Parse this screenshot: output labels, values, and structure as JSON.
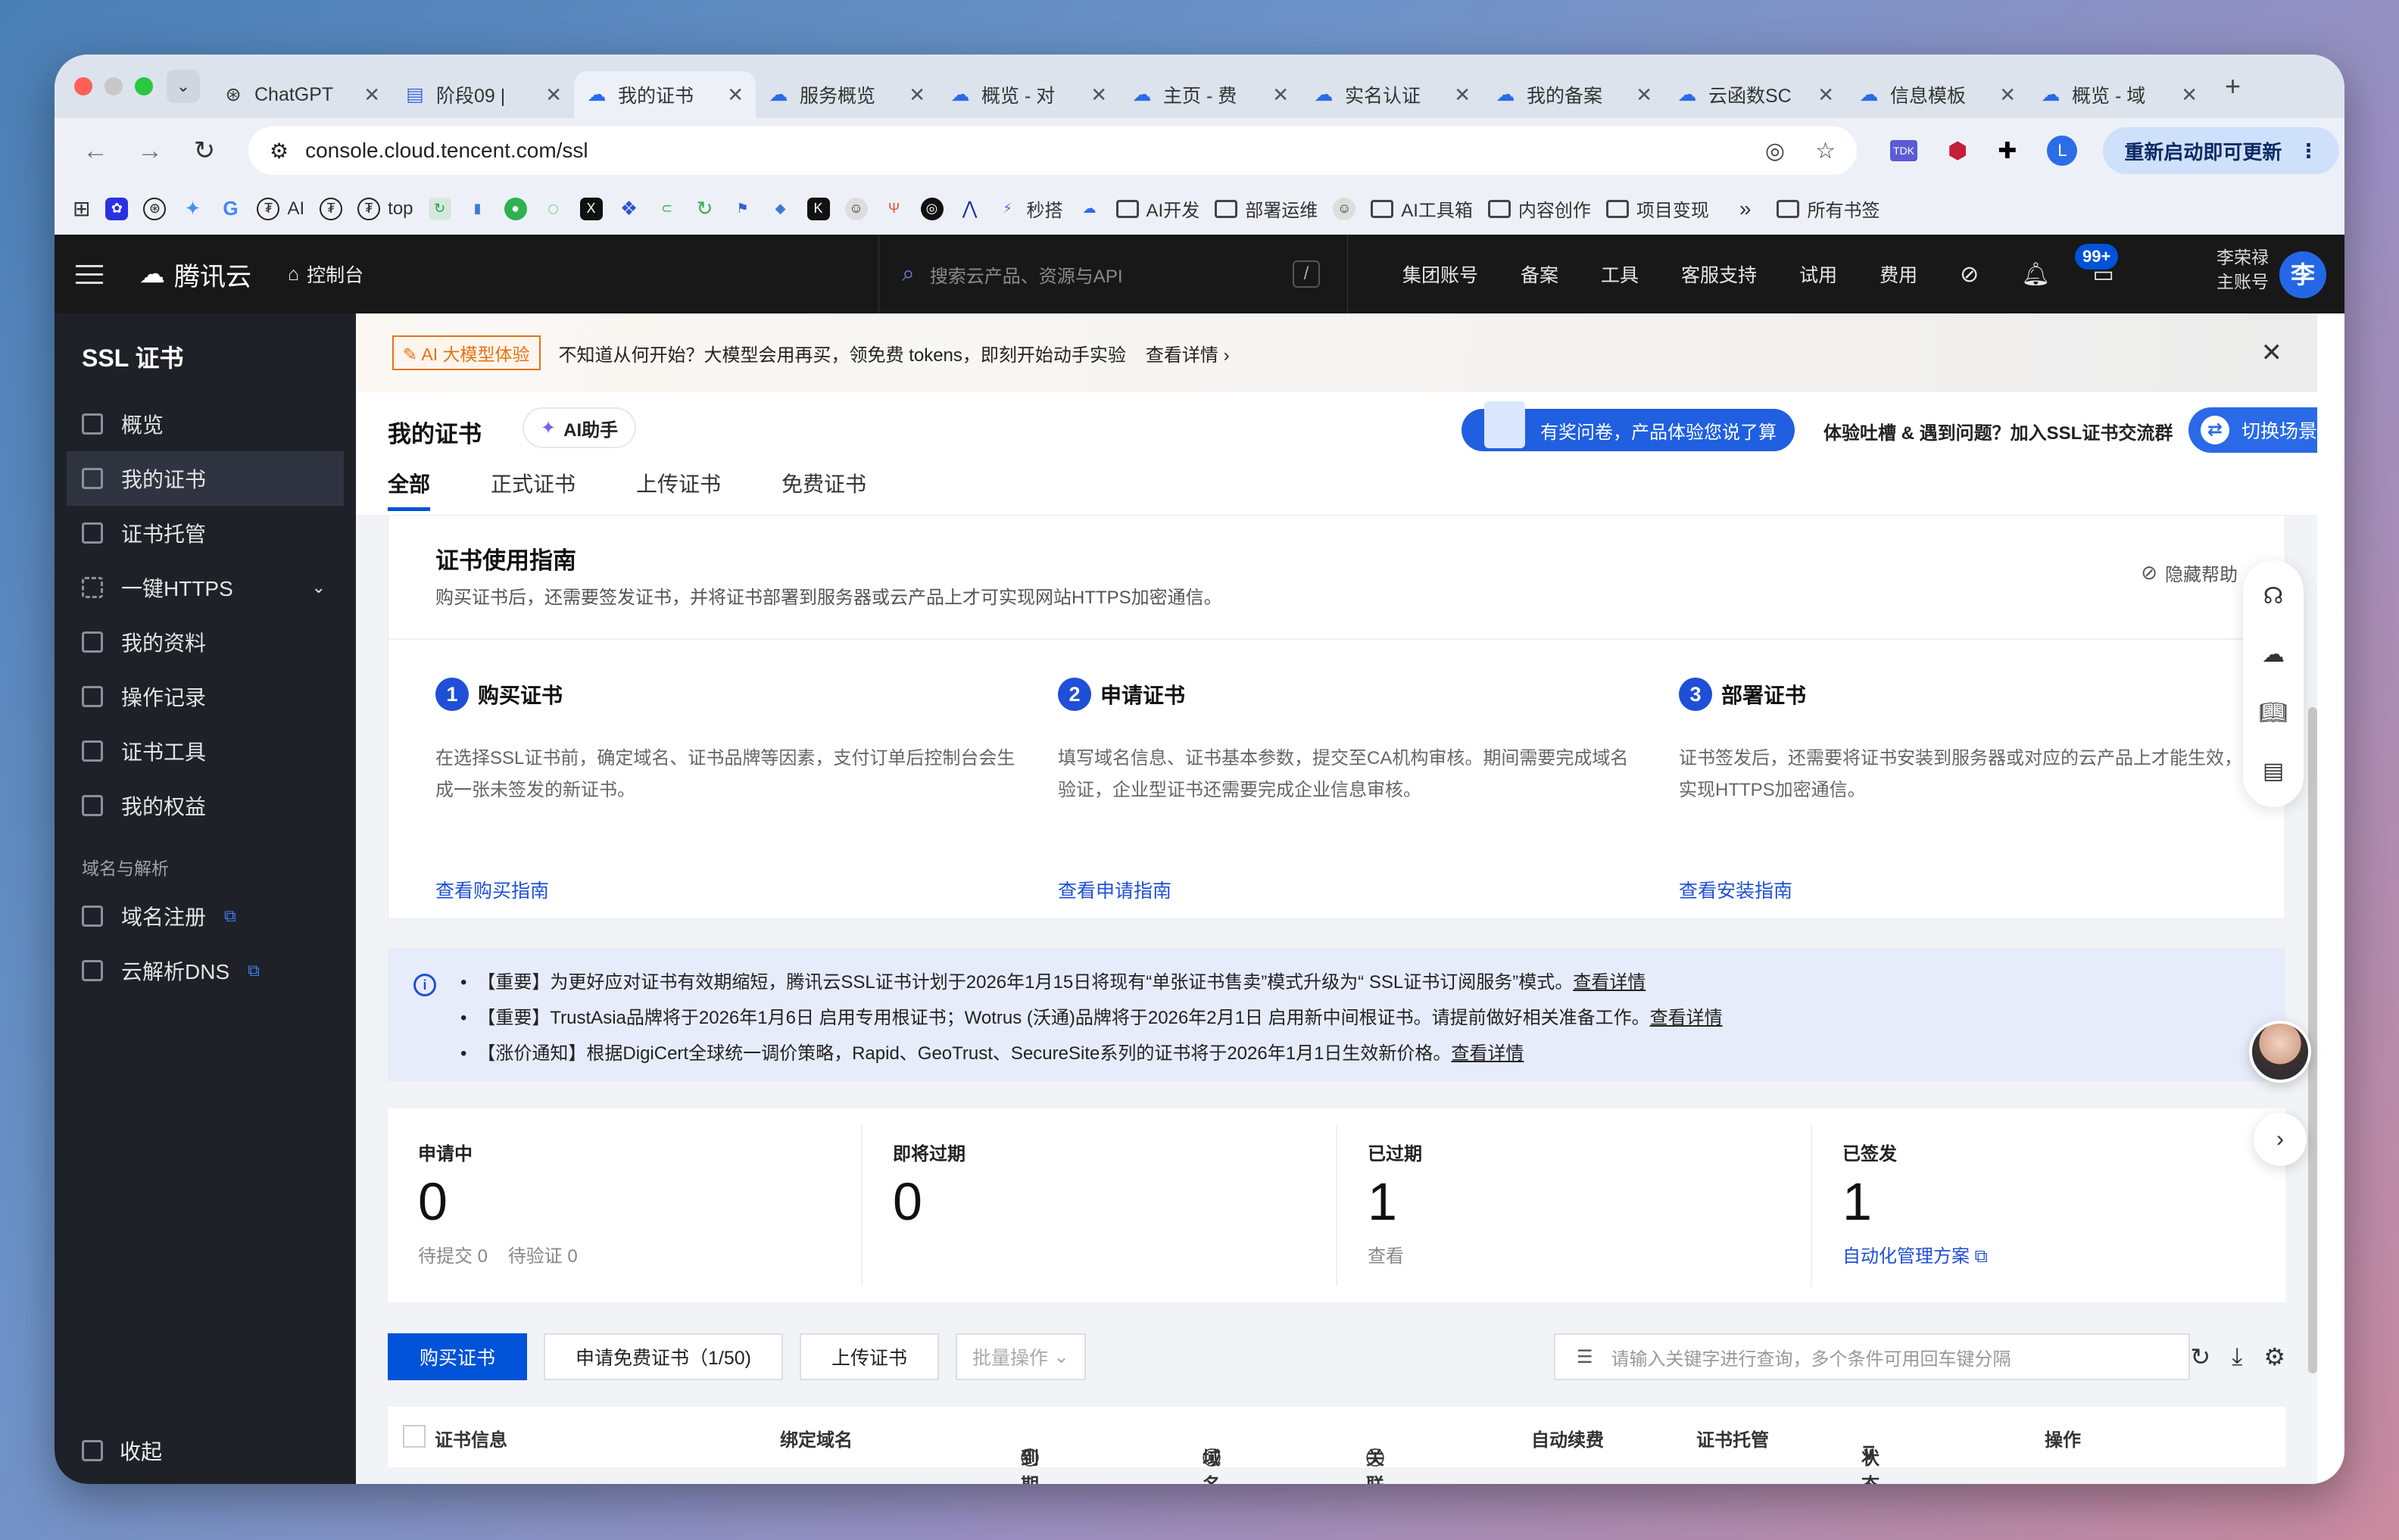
{
  "browser": {
    "tabs": [
      {
        "title": "ChatGPT",
        "icon": "chatgpt-icon",
        "active": false
      },
      {
        "title": "阶段09 |",
        "icon": "doc-icon",
        "active": false
      },
      {
        "title": "我的证书",
        "icon": "cloud-icon",
        "active": true
      },
      {
        "title": "服务概览",
        "icon": "cloud-icon",
        "active": false
      },
      {
        "title": "概览 - 对",
        "icon": "cloud-icon",
        "active": false
      },
      {
        "title": "主页 - 费",
        "icon": "cloud-icon",
        "active": false
      },
      {
        "title": "实名认证",
        "icon": "cloud-icon",
        "active": false
      },
      {
        "title": "我的备案",
        "icon": "cloud-icon",
        "active": false
      },
      {
        "title": "云函数SC",
        "icon": "cloud-icon",
        "active": false
      },
      {
        "title": "信息模板",
        "icon": "cloud-icon",
        "active": false
      },
      {
        "title": "概览 - 域",
        "icon": "cloud-icon",
        "active": false
      }
    ],
    "url": "console.cloud.tencent.com/ssl",
    "relaunch_label": "重新启动即可更新",
    "profile_letter": "L",
    "bookmarks": [
      {
        "label": "AI",
        "color": "#222"
      },
      {
        "label": "top",
        "color": "#222"
      },
      {
        "label": "秒搭",
        "color": "#4b6cf0"
      },
      {
        "label": "AI开发",
        "folder": true
      },
      {
        "label": "部署运维",
        "folder": true
      },
      {
        "label": "AI工具箱",
        "folder": true
      },
      {
        "label": "内容创作",
        "folder": true
      },
      {
        "label": "项目变现",
        "folder": true
      },
      {
        "label": "所有书签",
        "folder": true
      }
    ]
  },
  "topbar": {
    "logo": "腾讯云",
    "console": "控制台",
    "search_placeholder": "搜索云产品、资源与API",
    "slash": "/",
    "nav": [
      "集团账号",
      "备案",
      "工具",
      "客服支持",
      "试用",
      "费用"
    ],
    "badge": "99+",
    "user_name": "李荣禄",
    "user_role": "主账号",
    "avatar_letter": "李"
  },
  "sidebar": {
    "title": "SSL 证书",
    "items": [
      {
        "label": "概览"
      },
      {
        "label": "我的证书",
        "active": true
      },
      {
        "label": "证书托管"
      },
      {
        "label": "一键HTTPS",
        "expand": true
      },
      {
        "label": "我的资料"
      },
      {
        "label": "操作记录"
      },
      {
        "label": "证书工具"
      },
      {
        "label": "我的权益"
      }
    ],
    "group": "域名与解析",
    "group_items": [
      {
        "label": "域名注册"
      },
      {
        "label": "云解析DNS"
      }
    ],
    "collapse": "收起"
  },
  "banner": {
    "tag": "AI 大模型体验",
    "text": "不知道从何开始？大模型会用再买，领免费 tokens，即刻开始动手实验",
    "link": "查看详情"
  },
  "header": {
    "title": "我的证书",
    "ai_button": "AI助手",
    "survey": "有奖问卷，产品体验您说了算",
    "feedback": "体验吐槽 & 遇到问题？加入SSL证书交流群",
    "switch": "切换场景",
    "tabs": [
      "全部",
      "正式证书",
      "上传证书",
      "免费证书"
    ]
  },
  "guide": {
    "title": "证书使用指南",
    "subtitle": "购买证书后，还需要签发证书，并将证书部署到服务器或云产品上才可实现网站HTTPS加密通信。",
    "hide": "隐藏帮助",
    "steps": [
      {
        "num": "1",
        "title": "购买证书",
        "desc1": "在选择SSL证书前，确定域名、证书品牌等因素，支付订单后控制台会生",
        "desc2": "成一张未签发的新证书。",
        "link": "查看购买指南"
      },
      {
        "num": "2",
        "title": "申请证书",
        "desc1": "填写域名信息、证书基本参数，提交至CA机构审核。期间需要完成域名",
        "desc2": "验证，企业型证书还需要完成企业信息审核。",
        "link": "查看申请指南"
      },
      {
        "num": "3",
        "title": "部署证书",
        "desc1": "证书签发后，还需要将证书安装到服务器或对应的云产品上才能生效，",
        "desc2": "实现HTTPS加密通信。",
        "link": "查看安装指南"
      }
    ]
  },
  "notice": {
    "items": [
      {
        "text": "【重要】为更好应对证书有效期缩短，腾讯云SSL证书计划于2026年1月15日将现有“单张证书售卖”模式升级为“ SSL证书订阅服务”模式。",
        "link": "查看详情"
      },
      {
        "text": "【重要】TrustAsia品牌将于2026年1月6日 启用专用根证书；Wotrus (沃通)品牌将于2026年2月1日 启用新中间根证书。请提前做好相关准备工作。",
        "link": "查看详情"
      },
      {
        "text": "【涨价通知】根据DigiCert全球统一调价策略，Rapid、GeoTrust、SecureSite系列的证书将于2026年1月1日生效新价格。",
        "link": "查看详情"
      }
    ]
  },
  "stats": [
    {
      "label": "申请中",
      "value": "0",
      "foot1": "待提交 0",
      "foot2": "待验证 0"
    },
    {
      "label": "即将过期",
      "value": "0"
    },
    {
      "label": "已过期",
      "value": "1",
      "foot1": "查看"
    },
    {
      "label": "已签发",
      "value": "1",
      "foot1": "自动化管理方案"
    }
  ],
  "toolbar": {
    "buy": "购买证书",
    "apply_free": "申请免费证书（1/50)",
    "upload": "上传证书",
    "batch": "批量操作",
    "search_placeholder": "请输入关键字进行查询，多个条件可用回车键分隔"
  },
  "table": {
    "columns": [
      "证书信息",
      "绑定域名",
      "到期时间",
      "域名解析",
      "关联资源",
      "自动续费",
      "证书托管",
      "状态",
      "操作"
    ]
  }
}
